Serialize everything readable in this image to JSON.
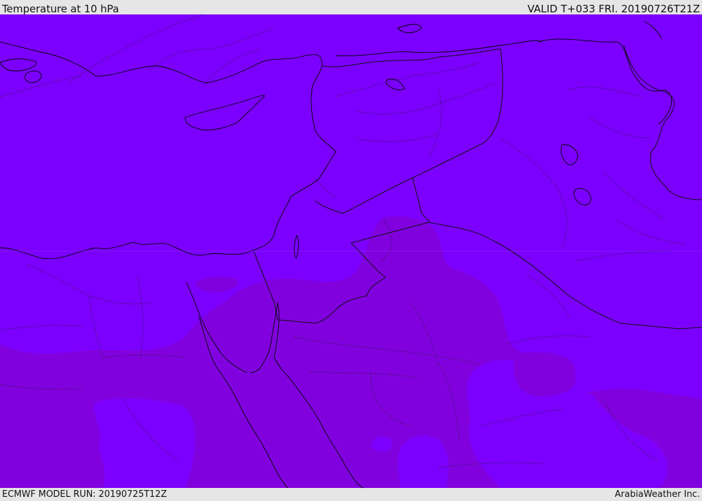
{
  "header": {
    "title": "Temperature at 10 hPa",
    "valid": "VALID T+033 FRI. 20190726T21Z"
  },
  "footer": {
    "model_run": "ECMWF MODEL RUN: 20190725T12Z",
    "brand": "ArabiaWeather Inc."
  },
  "colors": {
    "field_light": "#7b00ff",
    "field_dark": "#8100de",
    "coast": "#000000",
    "border": "#111111"
  }
}
